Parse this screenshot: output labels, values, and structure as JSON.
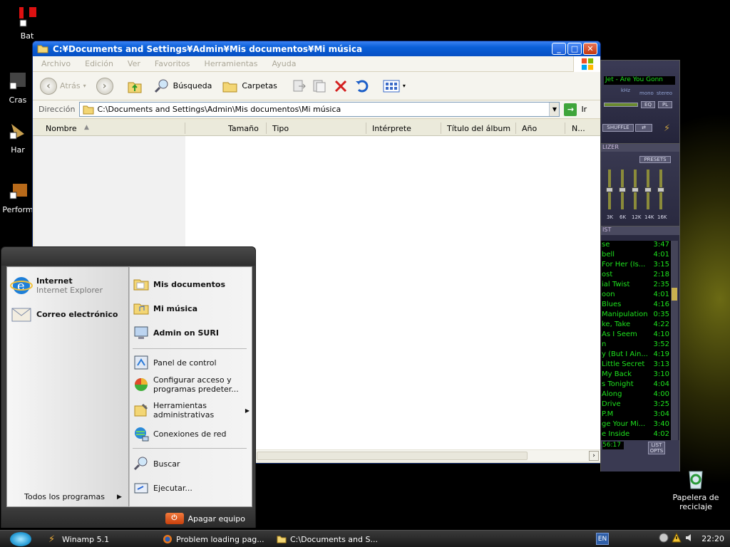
{
  "desktop": {
    "icons": [
      {
        "label": "Bat"
      },
      {
        "label": "Cras"
      },
      {
        "label": "Har"
      },
      {
        "label": "Perform"
      },
      {
        "label": "Papelera de reciclaje"
      }
    ]
  },
  "explorer": {
    "title": "C:¥Documents and Settings¥Admin¥Mis documentos¥Mi música",
    "menu": [
      "Archivo",
      "Edición",
      "Ver",
      "Favoritos",
      "Herramientas",
      "Ayuda"
    ],
    "toolbar": {
      "back": "Atrás",
      "search": "Búsqueda",
      "folders": "Carpetas"
    },
    "address": {
      "label": "Dirección",
      "value": "C:\\Documents and Settings\\Admin\\Mis documentos\\Mi música",
      "go": "Ir"
    },
    "columns": [
      "Nombre",
      "Tamaño",
      "Tipo",
      "Intérprete",
      "Título del álbum",
      "Año",
      "N..."
    ]
  },
  "winamp": {
    "title_text": "Jet - Are You Gonn",
    "khz": "kHz",
    "mono": "mono",
    "stereo": "stereo",
    "eq_btn": "EQ",
    "pl_btn": "PL",
    "shuffle": "SHUFFLE",
    "eq_title": "LIZER",
    "presets": "PRESETS",
    "eq_bands": [
      "3K",
      "6K",
      "12K",
      "14K",
      "16K"
    ],
    "eq_levels": [
      0.5,
      0.5,
      0.5,
      0.5,
      0.5
    ],
    "pl_title": "IST",
    "playlist": [
      {
        "t": "se",
        "d": "3:47"
      },
      {
        "t": "bell",
        "d": "4:01"
      },
      {
        "t": "For Her (Is...",
        "d": "3:15"
      },
      {
        "t": "ost",
        "d": "2:18"
      },
      {
        "t": "ial Twist",
        "d": "2:35"
      },
      {
        "t": "oon",
        "d": "4:01"
      },
      {
        "t": "Blues",
        "d": "4:16"
      },
      {
        "t": "Manipulation",
        "d": "0:35"
      },
      {
        "t": "ke, Take",
        "d": "4:22"
      },
      {
        "t": "As I Seem",
        "d": "4:10"
      },
      {
        "t": "n",
        "d": "3:52"
      },
      {
        "t": "y (But I Ain...",
        "d": "4:19"
      },
      {
        "t": "Little Secret",
        "d": "3:13"
      },
      {
        "t": "My Back",
        "d": "3:10"
      },
      {
        "t": "s Tonight",
        "d": "4:04"
      },
      {
        "t": "Along",
        "d": "4:00"
      },
      {
        "t": "Drive",
        "d": "3:25"
      },
      {
        "t": "P.M",
        "d": "3:04"
      },
      {
        "t": "ge Your Mi...",
        "d": "3:40"
      },
      {
        "t": "e Inside",
        "d": "4:02"
      }
    ],
    "total_time": "56:17",
    "list_opts": "LIST OPTS"
  },
  "startmenu": {
    "pinned": [
      {
        "title": "Internet",
        "sub": "Internet Explorer"
      },
      {
        "title": "Correo electrónico",
        "sub": ""
      }
    ],
    "all_programs": "Todos los programas",
    "places": [
      "Mis documentos",
      "Mi música",
      "Admin on SURI"
    ],
    "settings": [
      "Panel de control",
      "Configurar acceso y programas predeter...",
      "Herramientas administrativas",
      "Conexiones de red"
    ],
    "search": "Buscar",
    "run": "Ejecutar...",
    "shutdown": "Apagar equipo"
  },
  "taskbar": {
    "tasks": [
      "Winamp 5.1",
      "Problem loading pag...",
      "C:\\Documents and S..."
    ],
    "lang": "EN",
    "clock": "22:20"
  },
  "colors": {
    "xp_blue": "#0a5fd8",
    "winamp_green": "#1ee31e",
    "taskbar": "#2a2a2a"
  }
}
